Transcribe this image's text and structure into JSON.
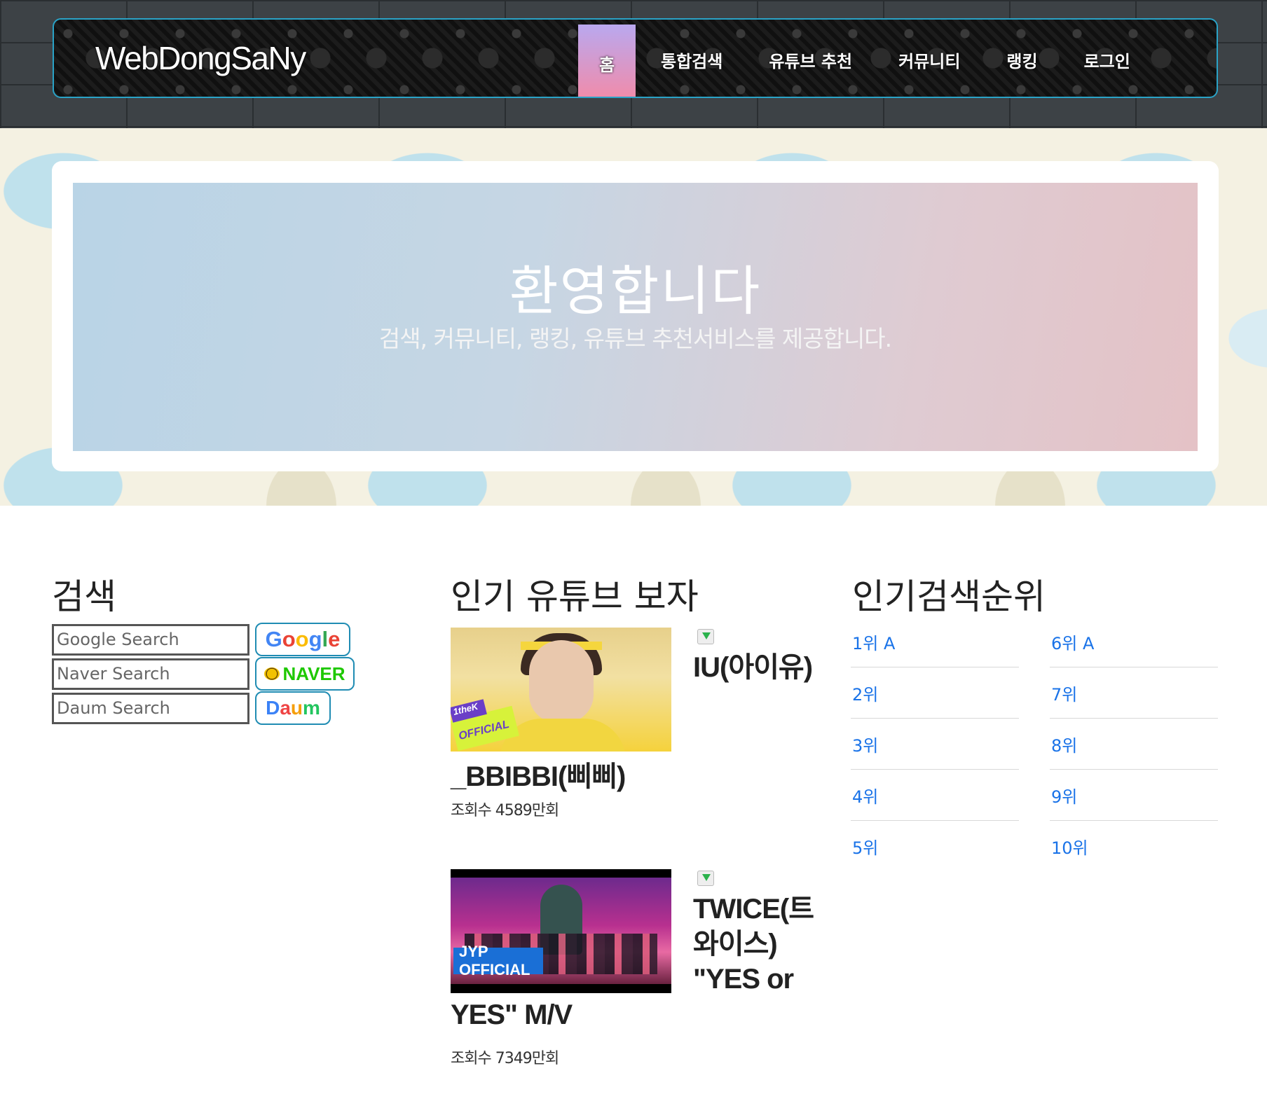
{
  "brand": "WebDongSaNy",
  "nav": [
    "홈",
    "통합검색",
    "유튜브 추천",
    "커뮤니티",
    "랭킹",
    "로그인"
  ],
  "hero": {
    "title": "환영합니다",
    "subtitle": "검색, 커뮤니티, 랭킹, 유튜브 추천서비스를 제공합니다."
  },
  "search": {
    "title": "검색",
    "google_placeholder": "Google Search",
    "naver_placeholder": "Naver Search",
    "daum_placeholder": "Daum Search",
    "naver_label": "NAVER"
  },
  "youtube": {
    "title": "인기 유튜브 보자",
    "videos": [
      {
        "title_side": "IU(아이유)",
        "title_tail": "_BBIBBI(삐삐)",
        "views": "조회수 4589만회",
        "badge": "OFFICIAL",
        "badge2": "1theK"
      },
      {
        "title_side": "TWICE(트와이스) \"YES or",
        "title_tail": "YES\" M/V",
        "views": "조회수 7349만회",
        "badge": "JYP OFFICIAL"
      }
    ]
  },
  "ranking": {
    "title": "인기검색순위",
    "left": [
      "1위 A",
      "2위",
      "3위",
      "4위",
      "5위"
    ],
    "right": [
      "6위 A",
      "7위",
      "8위",
      "9위",
      "10위"
    ]
  }
}
